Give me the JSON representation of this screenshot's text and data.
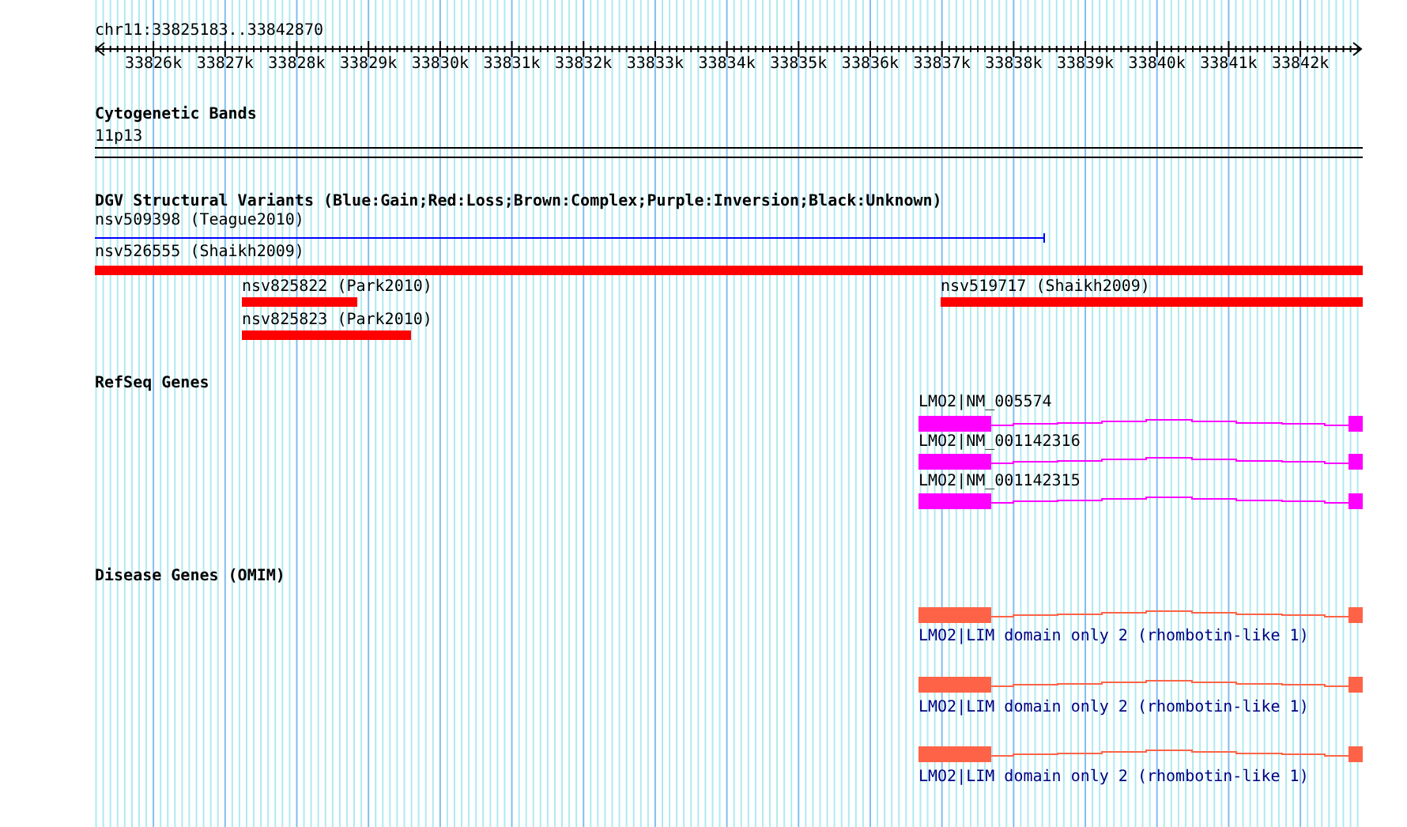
{
  "ruler": {
    "range": "chr11:33825183..33842870",
    "ticks": [
      "33826k",
      "33827k",
      "33828k",
      "33829k",
      "33830k",
      "33831k",
      "33832k",
      "33833k",
      "33834k",
      "33835k",
      "33836k",
      "33837k",
      "33838k",
      "33839k",
      "33840k",
      "33841k",
      "33842k"
    ]
  },
  "tracks": [
    {
      "kind": "cytoband",
      "title": "Cytogenetic Bands",
      "band": "11p13"
    },
    {
      "kind": "variants",
      "title": "DGV Structural Variants (Blue:Gain;Red:Loss;Brown:Complex;Purple:Inversion;Black:Unknown)",
      "features": [
        {
          "label": "nsv509398 (Teague2010)",
          "kind": "line",
          "color": "#0000ff"
        },
        {
          "label": "nsv526555 (Shaikh2009)",
          "kind": "bar",
          "color": "#ff0000"
        },
        {
          "label": "nsv825822 (Park2010)",
          "kind": "bar",
          "color": "#ff0000"
        },
        {
          "label": "nsv519717 (Shaikh2009)",
          "kind": "bar",
          "color": "#ff0000"
        },
        {
          "label": "nsv825823 (Park2010)",
          "kind": "bar",
          "color": "#ff0000"
        }
      ]
    },
    {
      "kind": "genes",
      "title": "RefSeq Genes",
      "features": [
        {
          "label": "LMO2|NM_005574",
          "color": "#ff00ff"
        },
        {
          "label": "LMO2|NM_001142316",
          "color": "#ff00ff"
        },
        {
          "label": "LMO2|NM_001142315",
          "color": "#ff00ff"
        }
      ]
    },
    {
      "kind": "disease",
      "title": "Disease Genes (OMIM)",
      "features": [
        {
          "label": "LMO2|LIM domain only 2 (rhombotin-like 1)",
          "color": "#ff6347"
        },
        {
          "label": "LMO2|LIM domain only 2 (rhombotin-like 1)",
          "color": "#ff6347"
        },
        {
          "label": "LMO2|LIM domain only 2 (rhombotin-like 1)",
          "color": "#ff6347"
        }
      ]
    }
  ]
}
